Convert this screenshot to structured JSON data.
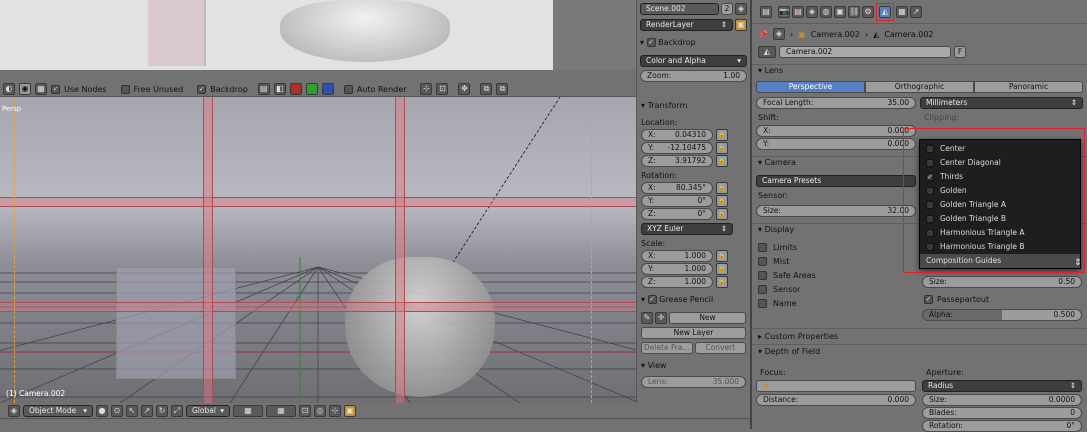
{
  "viewport": {
    "corner_label": "Persp",
    "object_label": "(1) Camera.002"
  },
  "viewport_header": {
    "use_nodes_label": "Use Nodes",
    "free_unused_label": "Free Unused",
    "backdrop_label": "Backdrop",
    "auto_render_label": "Auto Render"
  },
  "bottom_bar": {
    "mode": "Object Mode",
    "orientation": "Global"
  },
  "node_sidebar": {
    "scene": "Scene.002",
    "scene_users": "2",
    "layer": "RenderLayer",
    "backdrop_title": "Backdrop",
    "color_mode": "Color and Alpha",
    "zoom_label": "Zoom:",
    "zoom_value": "1.00"
  },
  "transform": {
    "title": "Transform",
    "location_label": "Location:",
    "location": [
      {
        "axis": "X:",
        "value": "0.04310"
      },
      {
        "axis": "Y:",
        "value": "-12.10475"
      },
      {
        "axis": "Z:",
        "value": "3.91792"
      }
    ],
    "rotation_label": "Rotation:",
    "rotation": [
      {
        "axis": "X:",
        "value": "80.345°"
      },
      {
        "axis": "Y:",
        "value": "0°"
      },
      {
        "axis": "Z:",
        "value": "0°"
      }
    ],
    "rotation_mode": "XYZ Euler",
    "scale_label": "Scale:",
    "scale": [
      {
        "axis": "X:",
        "value": "1.000"
      },
      {
        "axis": "Y:",
        "value": "1.000"
      },
      {
        "axis": "Z:",
        "value": "1.000"
      }
    ],
    "grease_title": "Grease Pencil",
    "new_label": "New",
    "new_layer_label": "New Layer",
    "delete_frame_label": "Delete Fra...",
    "convert_label": "Convert",
    "view_title": "View",
    "lens_label": "Lens:",
    "lens_value": "35.000"
  },
  "properties": {
    "breadcrumb_1": "Camera.002",
    "breadcrumb_2": "Camera.002",
    "datablock_name": "Camera.002",
    "fake_user": "F",
    "lens_title": "Lens",
    "tabs": [
      "Perspective",
      "Orthographic",
      "Panoramic"
    ],
    "focal_length_label": "Focal Length:",
    "focal_length_value": "35.00",
    "unit": "Millimeters",
    "shift_label": "Shift:",
    "clipping_label": "Clipping:",
    "shift_x_label": "X:",
    "shift_x_value": "0.000",
    "shift_y_label": "Y:",
    "shift_y_value": "0.000",
    "camera_title": "Camera",
    "camera_presets": "Camera Presets",
    "sensor_label": "Sensor:",
    "size_label": "Size:",
    "size_value": "32.00",
    "display_title": "Display",
    "display_checks": [
      "Limits",
      "Mist",
      "Safe Areas",
      "Sensor",
      "Name"
    ],
    "guide_size_label": "Size:",
    "guide_size_value": "0.50",
    "passepartout_label": "Passepartout",
    "alpha_label": "Alpha:",
    "alpha_value": "0.500",
    "custom_props_title": "Custom Properties",
    "dof_title": "Depth of Field",
    "focus_label": "Focus:",
    "aperture_label": "Aperture:",
    "aperture_mode": "Radius",
    "distance_label": "Distance:",
    "distance_value": "0.000",
    "ap_size_label": "Size:",
    "ap_size_value": "0.0000",
    "blades_label": "Blades:",
    "blades_value": "0",
    "ap_rotation_label": "Rotation:",
    "ap_rotation_value": "0°"
  },
  "composition_menu": {
    "items": [
      "Center",
      "Center Diagonal",
      "Thirds",
      "Golden",
      "Golden Triangle A",
      "Golden Triangle B",
      "Harmonious Triangle A",
      "Harmonious Triangle B"
    ],
    "checked": [
      false,
      false,
      true,
      false,
      false,
      false,
      false,
      false
    ],
    "footer": "Composition Guides"
  },
  "colors": {
    "accent_blue": "#5680c2",
    "highlight_red": "#e0202a",
    "guide_pink": "#dc7882"
  }
}
